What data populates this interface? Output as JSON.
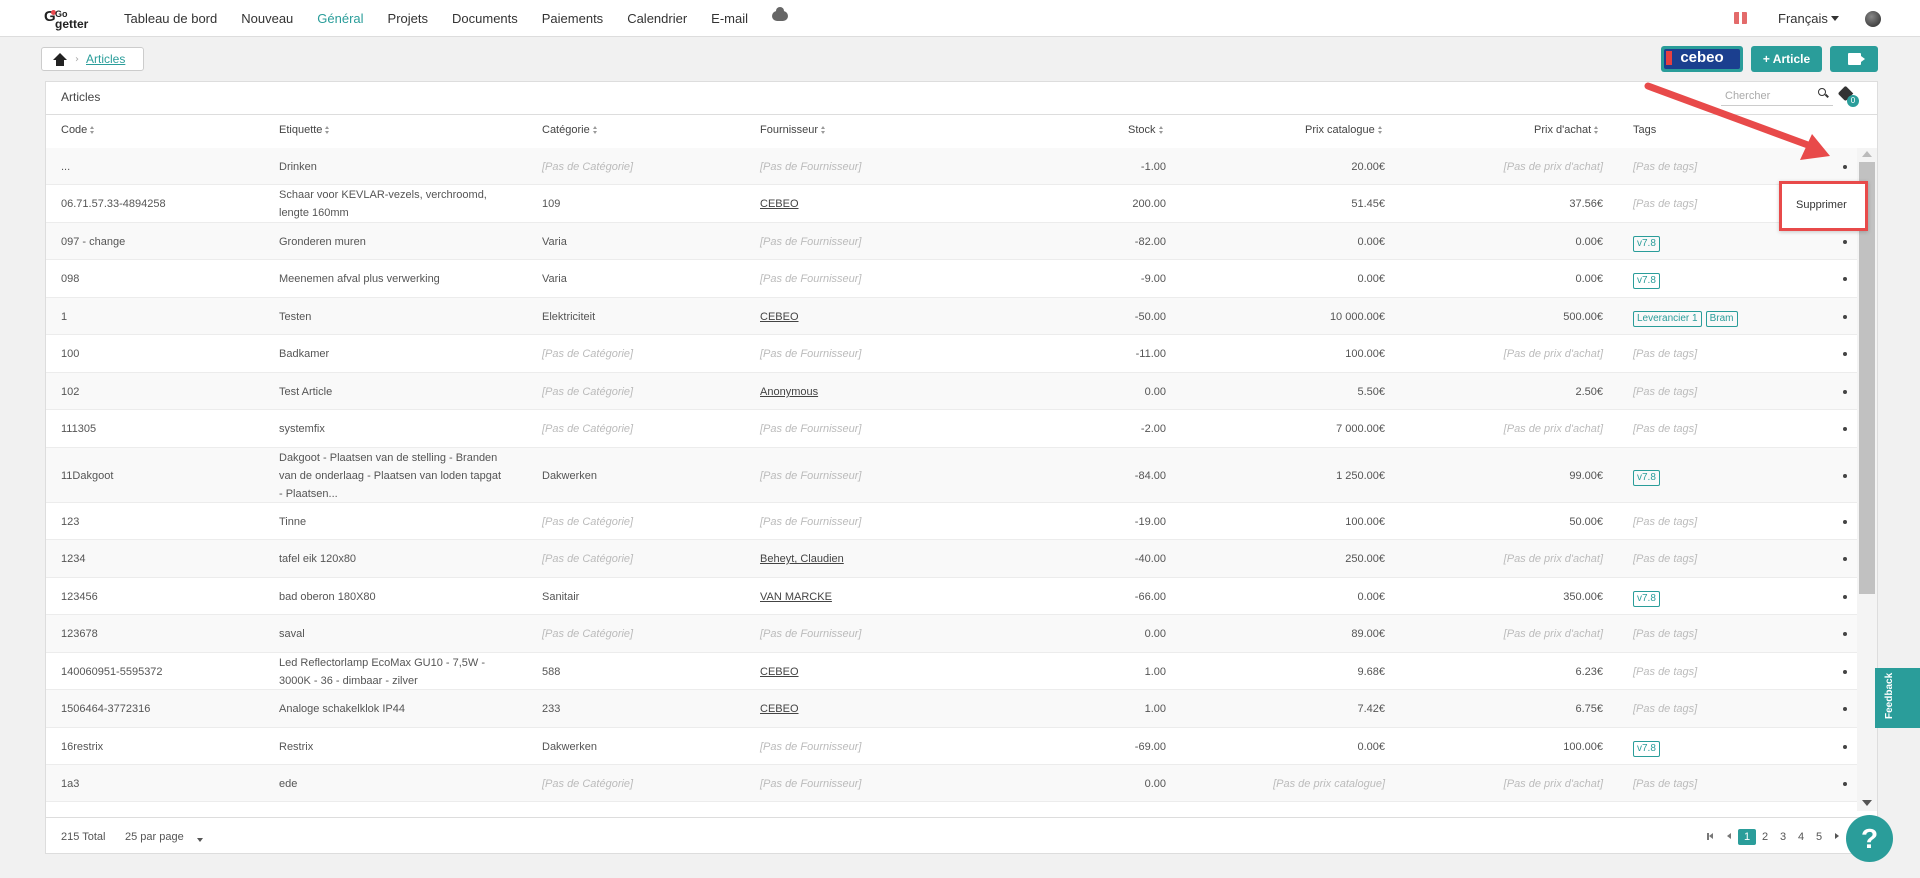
{
  "nav": {
    "logo_go": "Go",
    "logo_getter": "getter",
    "items": [
      {
        "label": "Tableau de bord"
      },
      {
        "label": "Nouveau"
      },
      {
        "label": "Général"
      },
      {
        "label": "Projets"
      },
      {
        "label": "Documents"
      },
      {
        "label": "Paiements"
      },
      {
        "label": "Calendrier"
      },
      {
        "label": "E-mail"
      }
    ],
    "language": "Français"
  },
  "breadcrumb": {
    "current": "Articles"
  },
  "toolbar": {
    "cebeo_label": "cebeo",
    "add_article_label": "+ Article"
  },
  "panel": {
    "title": "Articles",
    "search_placeholder": "Chercher",
    "tag_filter_count": "0"
  },
  "columns": {
    "code": "Code",
    "etiquette": "Etiquette",
    "categorie": "Catégorie",
    "fournisseur": "Fournisseur",
    "stock": "Stock",
    "prix_catalogue": "Prix catalogue",
    "prix_achat": "Prix d'achat",
    "tags": "Tags"
  },
  "rows": [
    {
      "code": "...",
      "etiquette": "Drinken",
      "categorie": "[Pas de Catégorie]",
      "fournisseur": "[Pas de Fournisseur]",
      "stock": "-1.00",
      "prix_catalogue": "20.00€",
      "prix_achat": "[Pas de prix d'achat]",
      "tags_empty": "[Pas de tags]"
    },
    {
      "code": "06.71.57.33-4894258",
      "etiquette": "Schaar voor KEVLAR-vezels, verchroomd, lengte 160mm",
      "categorie": "109",
      "fournisseur": "CEBEO",
      "stock": "200.00",
      "prix_catalogue": "51.45€",
      "prix_achat": "37.56€",
      "tags_empty": "[Pas de tags]"
    },
    {
      "code": "097 - change",
      "etiquette": "Gronderen muren",
      "categorie": "Varia",
      "fournisseur": "[Pas de Fournisseur]",
      "stock": "-82.00",
      "prix_catalogue": "0.00€",
      "prix_achat": "0.00€",
      "tags": [
        "v7.8"
      ]
    },
    {
      "code": "098",
      "etiquette": "Meenemen afval plus verwerking",
      "categorie": "Varia",
      "fournisseur": "[Pas de Fournisseur]",
      "stock": "-9.00",
      "prix_catalogue": "0.00€",
      "prix_achat": "0.00€",
      "tags": [
        "v7.8"
      ]
    },
    {
      "code": "1",
      "etiquette": "Testen",
      "categorie": "Elektriciteit",
      "fournisseur": "CEBEO",
      "stock": "-50.00",
      "prix_catalogue": "10 000.00€",
      "prix_achat": "500.00€",
      "tags": [
        "Leverancier 1",
        "Bram"
      ]
    },
    {
      "code": "100",
      "etiquette": "Badkamer",
      "categorie": "[Pas de Catégorie]",
      "fournisseur": "[Pas de Fournisseur]",
      "stock": "-11.00",
      "prix_catalogue": "100.00€",
      "prix_achat": "[Pas de prix d'achat]",
      "tags_empty": "[Pas de tags]"
    },
    {
      "code": "102",
      "etiquette": "Test Article",
      "categorie": "[Pas de Catégorie]",
      "fournisseur": "Anonymous",
      "stock": "0.00",
      "prix_catalogue": "5.50€",
      "prix_achat": "2.50€",
      "tags_empty": "[Pas de tags]"
    },
    {
      "code": "111305",
      "etiquette": "systemfix",
      "categorie": "[Pas de Catégorie]",
      "fournisseur": "[Pas de Fournisseur]",
      "stock": "-2.00",
      "prix_catalogue": "7 000.00€",
      "prix_achat": "[Pas de prix d'achat]",
      "tags_empty": "[Pas de tags]"
    },
    {
      "code": "11Dakgoot",
      "etiquette": "Dakgoot - Plaatsen van de stelling - Branden van de onderlaag - Plaatsen van loden tapgat - Plaatsen...",
      "categorie": "Dakwerken",
      "fournisseur": "[Pas de Fournisseur]",
      "stock": "-84.00",
      "prix_catalogue": "1 250.00€",
      "prix_achat": "99.00€",
      "tags": [
        "v7.8"
      ]
    },
    {
      "code": "123",
      "etiquette": "Tinne",
      "categorie": "[Pas de Catégorie]",
      "fournisseur": "[Pas de Fournisseur]",
      "stock": "-19.00",
      "prix_catalogue": "100.00€",
      "prix_achat": "50.00€",
      "tags_empty": "[Pas de tags]"
    },
    {
      "code": "1234",
      "etiquette": "tafel eik 120x80",
      "categorie": "[Pas de Catégorie]",
      "fournisseur": "Beheyt, Claudien",
      "stock": "-40.00",
      "prix_catalogue": "250.00€",
      "prix_achat": "[Pas de prix d'achat]",
      "tags_empty": "[Pas de tags]"
    },
    {
      "code": "123456",
      "etiquette": "bad oberon 180X80",
      "categorie": "Sanitair",
      "fournisseur": "VAN MARCKE",
      "stock": "-66.00",
      "prix_catalogue": "0.00€",
      "prix_achat": "350.00€",
      "tags": [
        "v7.8"
      ]
    },
    {
      "code": "123678",
      "etiquette": "saval",
      "categorie": "[Pas de Catégorie]",
      "fournisseur": "[Pas de Fournisseur]",
      "stock": "0.00",
      "prix_catalogue": "89.00€",
      "prix_achat": "[Pas de prix d'achat]",
      "tags_empty": "[Pas de tags]"
    },
    {
      "code": "140060951-5595372",
      "etiquette": "Led Reflectorlamp EcoMax GU10 - 7,5W - 3000K - 36 - dimbaar - zilver",
      "categorie": "588",
      "fournisseur": "CEBEO",
      "stock": "1.00",
      "prix_catalogue": "9.68€",
      "prix_achat": "6.23€",
      "tags_empty": "[Pas de tags]"
    },
    {
      "code": "1506464-3772316",
      "etiquette": "Analoge schakelklok IP44",
      "categorie": "233",
      "fournisseur": "CEBEO",
      "stock": "1.00",
      "prix_catalogue": "7.42€",
      "prix_achat": "6.75€",
      "tags_empty": "[Pas de tags]"
    },
    {
      "code": "16restrix",
      "etiquette": "Restrix",
      "categorie": "Dakwerken",
      "fournisseur": "[Pas de Fournisseur]",
      "stock": "-69.00",
      "prix_catalogue": "0.00€",
      "prix_achat": "100.00€",
      "tags": [
        "v7.8"
      ]
    },
    {
      "code": "1a3",
      "etiquette": "ede",
      "categorie": "[Pas de Catégorie]",
      "fournisseur": "[Pas de Fournisseur]",
      "stock": "0.00",
      "prix_catalogue": "[Pas de prix catalogue]",
      "prix_achat": "[Pas de prix d'achat]",
      "tags_empty": "[Pas de tags]"
    }
  ],
  "footer": {
    "total": "215 Total",
    "per_page": "25 par page",
    "pages": [
      "1",
      "2",
      "3",
      "4",
      "5"
    ]
  },
  "context_menu": {
    "delete_label": "Supprimer"
  },
  "feedback_label": "Feedback",
  "help_label": "?",
  "colors": {
    "accent": "#2a9d9a",
    "annotation": "#e84a4a"
  }
}
